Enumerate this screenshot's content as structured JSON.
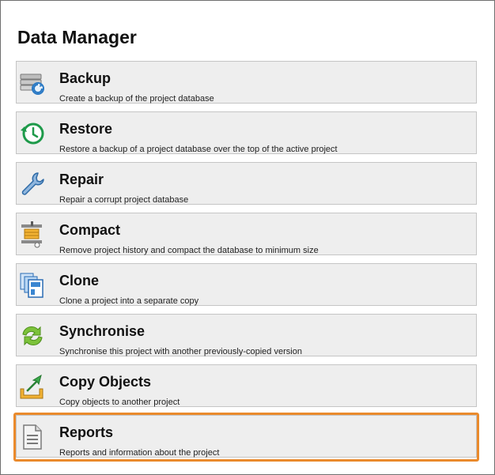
{
  "window": {
    "title": "Data Manager"
  },
  "items": [
    {
      "label": "Backup",
      "description": "Create a backup of the project database",
      "icon": "database-backup-icon"
    },
    {
      "label": "Restore",
      "description": "Restore a backup of a project database over the top of the active project",
      "icon": "restore-clock-icon"
    },
    {
      "label": "Repair",
      "description": "Repair a corrupt project database",
      "icon": "wrench-icon"
    },
    {
      "label": "Compact",
      "description": "Remove project history and compact the database to minimum size",
      "icon": "compact-clamp-icon"
    },
    {
      "label": "Clone",
      "description": "Clone a project into a separate copy",
      "icon": "clone-copies-icon"
    },
    {
      "label": "Synchronise",
      "description": "Synchronise this project with another previously-copied version",
      "icon": "sync-arrows-icon"
    },
    {
      "label": "Copy Objects",
      "description": "Copy objects to another project",
      "icon": "copy-export-icon"
    },
    {
      "label": "Reports",
      "description": "Reports and information about the project",
      "icon": "report-document-icon"
    }
  ],
  "colors": {
    "highlight": "#ea8a2c",
    "tile_bg": "#eeeeee",
    "tile_border": "#c5c5c5"
  }
}
